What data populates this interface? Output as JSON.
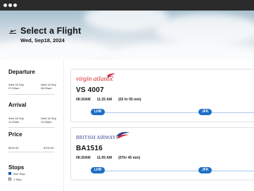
{
  "header": {
    "title": "Select a Flight",
    "date": "Wed, Sep18, 2024"
  },
  "filters": {
    "departure": {
      "label": "Departure",
      "from_date": "Wed 18 Sep",
      "from_time": "07:00am",
      "to_date": "Wed 18 Sep",
      "to_time": "06:00am"
    },
    "arrival": {
      "label": "Arrival",
      "from_date": "Wed 18 Sep",
      "from_time": "11:00am",
      "to_date": "Wed 18 Sep",
      "to_time": "12:00pm"
    },
    "price": {
      "label": "Price",
      "min": "$100.00",
      "max": "$700.00"
    },
    "stops": {
      "label": "Stops",
      "options": [
        {
          "label": "Non Stop",
          "checked": true
        },
        {
          "label": "1 Stop",
          "checked": false
        }
      ]
    }
  },
  "flights": [
    {
      "airline": "virgin atlantic",
      "flight_number": "VS 4007",
      "depart_time": "08:20AM",
      "arrive_time": "11:25 AM",
      "duration": "(03 hr 05 min)",
      "origin": "LHR",
      "destination": "JFK"
    },
    {
      "airline": "BRITISH AIRWAYS",
      "flight_number": "BA1516",
      "depart_time": "08:20AM",
      "arrive_time": "11:05 AM",
      "duration": "(07hr 45 min)",
      "origin": "LHR",
      "destination": "JFK"
    }
  ],
  "colors": {
    "accent": "#1f6fc5",
    "virgin_red": "#d6202a",
    "ba_navy": "#2a3f8f",
    "ba_red": "#d8262f",
    "chrome": "#2b2b2b"
  }
}
